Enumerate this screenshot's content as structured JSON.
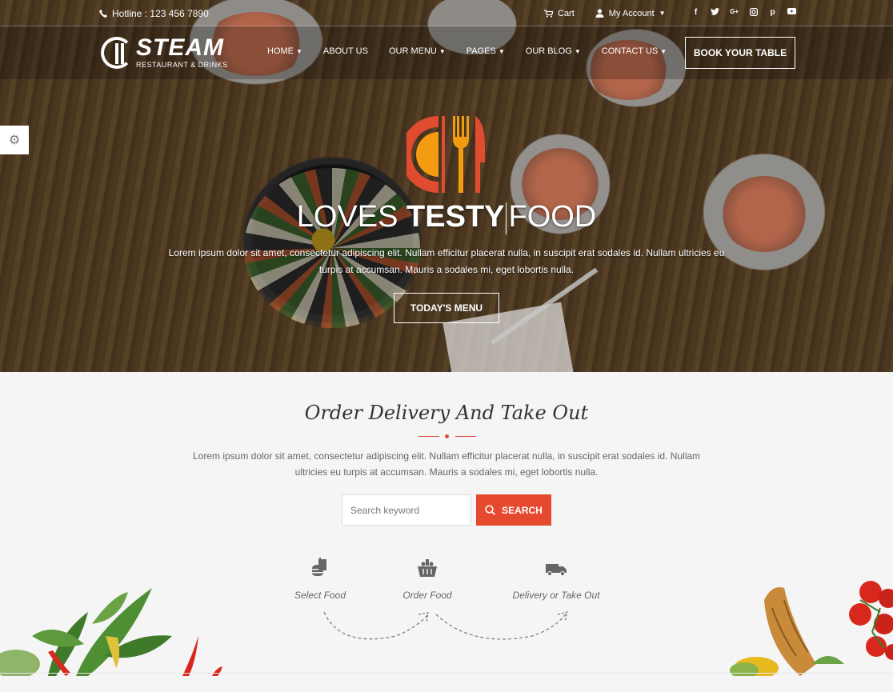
{
  "topbar": {
    "hotline": "Hotline : 123 456 7890",
    "cart": "Cart",
    "account": "My Account",
    "socials": [
      "facebook-icon",
      "twitter-icon",
      "google-plus-icon",
      "instagram-icon",
      "pinterest-icon",
      "youtube-icon"
    ]
  },
  "logo": {
    "name": "STEAM",
    "tagline": "RESTAURANT & DRINKS"
  },
  "nav": {
    "items": [
      {
        "label": "HOME",
        "dropdown": true
      },
      {
        "label": "ABOUT US",
        "dropdown": false
      },
      {
        "label": "OUR MENU",
        "dropdown": true
      },
      {
        "label": "PAGES",
        "dropdown": true
      },
      {
        "label": "OUR BLOG",
        "dropdown": true
      },
      {
        "label": "CONTACT US",
        "dropdown": true
      }
    ],
    "book_button": "BOOK YOUR TABLE"
  },
  "hero": {
    "title_a": "LOVES",
    "title_b": "TESTY",
    "title_c": "FOOD",
    "description": "Lorem ipsum dolor sit amet, consectetur adipiscing elit. Nullam efficitur placerat nulla, in suscipit erat sodales id. Nullam ultricies eu turpis at accumsan. Mauris a sodales mi, eget lobortis nulla.",
    "button": "TODAY'S MENU"
  },
  "order": {
    "title": "Order Delivery And Take Out",
    "description": "Lorem ipsum dolor sit amet, consectetur adipiscing elit. Nullam efficitur placerat nulla, in suscipit erat sodales id. Nullam ultricies eu turpis at accumsan. Mauris a sodales mi, eget lobortis nulla.",
    "search_placeholder": "Search keyword",
    "search_button": "SEARCH",
    "steps": [
      {
        "label": "Select Food",
        "icon": "burger-icon"
      },
      {
        "label": "Order Food",
        "icon": "basket-icon"
      },
      {
        "label": "Delivery or Take Out",
        "icon": "truck-icon"
      }
    ]
  },
  "colors": {
    "accent": "#e5492e",
    "logo_orange": "#f39c12",
    "logo_red": "#e14b2f"
  }
}
